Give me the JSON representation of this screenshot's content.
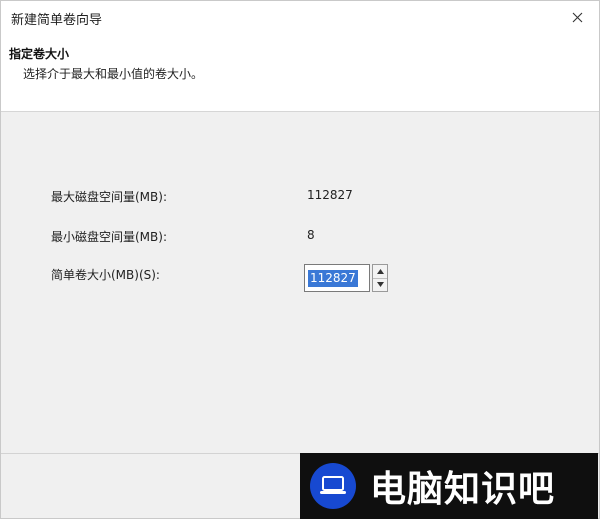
{
  "window": {
    "title": "新建简单卷向导"
  },
  "header": {
    "heading": "指定卷大小",
    "subheading": "选择介于最大和最小值的卷大小。"
  },
  "fields": {
    "max_label": "最大磁盘空间量(MB):",
    "max_value": "112827",
    "min_label": "最小磁盘空间量(MB):",
    "min_value": "8",
    "size_label": "简单卷大小(MB)(S):",
    "size_value": "112827"
  },
  "watermark": {
    "text": "电脑知识吧",
    "icon": "laptop-icon"
  },
  "colors": {
    "selection": "#3a78d6",
    "logo": "#1749d1",
    "banner": "#0f0f0f"
  }
}
